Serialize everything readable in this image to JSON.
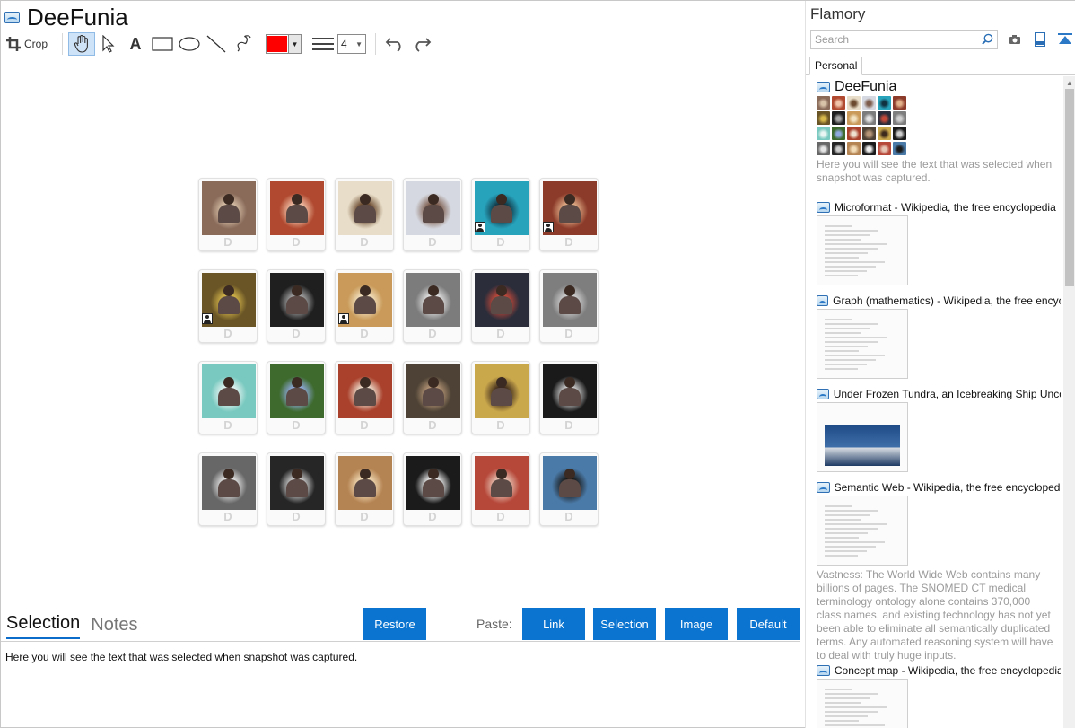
{
  "app": {
    "title": "DeeFunia"
  },
  "toolbar": {
    "crop_label": "Crop",
    "tools": [
      "hand-icon",
      "pointer-icon",
      "text-icon",
      "rectangle-icon",
      "ellipse-icon",
      "line-icon",
      "freehand-icon"
    ],
    "active_tool": "hand-icon",
    "color": "#ff0000",
    "line_width": "4"
  },
  "canvas": {
    "watermark": "D",
    "tiles": [
      {
        "bg": "#8a6b5a",
        "accent": "#d8c2a8",
        "badge": false
      },
      {
        "bg": "#b0492f",
        "accent": "#f1c3a9",
        "badge": false
      },
      {
        "bg": "#e8ddc8",
        "accent": "#6b4a2f",
        "badge": false
      },
      {
        "bg": "#d5d8e0",
        "accent": "#7d5c4c",
        "badge": false
      },
      {
        "bg": "#27a3bc",
        "accent": "#113341",
        "badge": true
      },
      {
        "bg": "#8c3b2a",
        "accent": "#e2b089",
        "badge": true
      },
      {
        "bg": "#6a5526",
        "accent": "#d7b84b",
        "badge": true
      },
      {
        "bg": "#1f1f1f",
        "accent": "#a6a6a6",
        "badge": false
      },
      {
        "bg": "#c99a59",
        "accent": "#f2e2c2",
        "badge": true
      },
      {
        "bg": "#7c7c7c",
        "accent": "#e4e4e4",
        "badge": false
      },
      {
        "bg": "#2b2d3a",
        "accent": "#c2493a",
        "badge": false
      },
      {
        "bg": "#7e7e7e",
        "accent": "#d0d0d0",
        "badge": false
      },
      {
        "bg": "#79c9c0",
        "accent": "#e8f5f2",
        "badge": false
      },
      {
        "bg": "#3e6a2e",
        "accent": "#90a9de",
        "badge": false
      },
      {
        "bg": "#a9412c",
        "accent": "#eee1d0",
        "badge": false
      },
      {
        "bg": "#4d4235",
        "accent": "#b59576",
        "badge": false
      },
      {
        "bg": "#c9a74b",
        "accent": "#3f2b1c",
        "badge": false
      },
      {
        "bg": "#1a1a1a",
        "accent": "#cfcfcf",
        "badge": false
      },
      {
        "bg": "#676767",
        "accent": "#e6e6e6",
        "badge": false
      },
      {
        "bg": "#262626",
        "accent": "#cfcfcf",
        "badge": false
      },
      {
        "bg": "#b58453",
        "accent": "#f2dcb7",
        "badge": false
      },
      {
        "bg": "#1b1b1b",
        "accent": "#f0f0f0",
        "badge": false
      },
      {
        "bg": "#b6483a",
        "accent": "#e7c5b5",
        "badge": false
      },
      {
        "bg": "#4a7aa8",
        "accent": "#1a1a1a",
        "badge": false
      }
    ]
  },
  "bottom": {
    "tabs": [
      "Selection",
      "Notes"
    ],
    "active_tab": "Selection",
    "restore_label": "Restore",
    "paste_label": "Paste:",
    "link_label": "Link",
    "selection_label": "Selection",
    "image_label": "Image",
    "default_label": "Default",
    "button_color": "#0a74d0",
    "selection_text": "Here you will see the text that was selected when snapshot was captured."
  },
  "flamory": {
    "title": "Flamory",
    "search_placeholder": "Search",
    "icons": [
      "camera-icon",
      "page-icon",
      "pin-icon"
    ],
    "tab_label": "Personal",
    "entries": [
      {
        "title": "DeeFunia",
        "desc": "Here you will see the text that was selected when snapshot was captured."
      },
      {
        "title": "Microformat - Wikipedia, the free encyclopedia",
        "desc": ""
      },
      {
        "title": "Graph (mathematics) - Wikipedia, the free encyclopedia",
        "desc": ""
      },
      {
        "title": "Under Frozen Tundra, an Icebreaking Ship Uncovers",
        "desc": ""
      },
      {
        "title": "Semantic Web - Wikipedia, the free encyclopedia",
        "desc": "Vastness: The World Wide Web contains many billions of pages. The SNOMED CT medical terminology ontology alone contains 370,000 class names, and existing technology has not yet been able to eliminate all semantically duplicated terms. Any automated reasoning system will have to deal with truly huge inputs."
      },
      {
        "title": "Concept map - Wikipedia, the free encyclopedia",
        "desc": ""
      }
    ]
  }
}
